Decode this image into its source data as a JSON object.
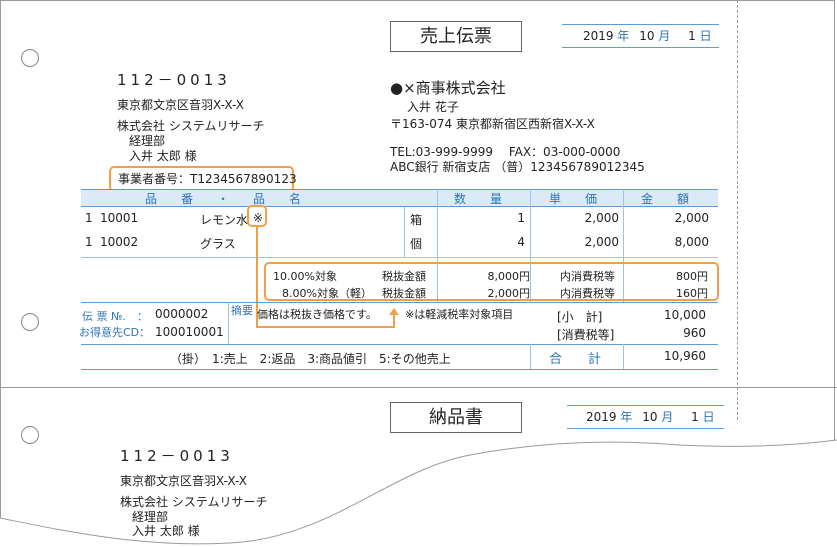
{
  "slip": {
    "title": "売上伝票",
    "date": {
      "year": "2019",
      "year_unit": "年",
      "month": "10",
      "month_unit": "月",
      "day": "1",
      "day_unit": "日"
    },
    "recipient": {
      "zip": "112－0013",
      "address": "東京都文京区音羽X-X-X",
      "company": "株式会社 システムリサーチ",
      "department": "経理部",
      "person": "入井 太郎 様"
    },
    "registration": "事業者番号：T1234567890123",
    "sender": {
      "company": "●×商事株式会社",
      "person": "入井 花子",
      "address": "〒163-074 東京都新宿区西新宿X-X-X",
      "tel_fax": "TEL:03-999-9999　 FAX：03-000-0000",
      "bank": "ABC銀行 新宿支店 （普）123456789012345"
    },
    "table": {
      "headers": {
        "item": "品　　番　　・　　品　　名",
        "quantity": "数　　量",
        "unit_price": "単　　価",
        "amount": "金　　額"
      },
      "rows": [
        {
          "no": "1",
          "code": "10001",
          "name": "レモン水",
          "mark": "※",
          "unit": "箱",
          "qty": "1",
          "price": "2,000",
          "amount": "2,000"
        },
        {
          "no": "1",
          "code": "10002",
          "name": "グラス",
          "mark": "",
          "unit": "個",
          "qty": "4",
          "price": "2,000",
          "amount": "8,000"
        }
      ],
      "tax_rows": [
        {
          "target": "10.00%対象",
          "label": "税抜金額",
          "value": "8,000円",
          "tax_label": "内消費税等",
          "tax": "800円"
        },
        {
          "target": "8.00%対象（軽）",
          "label": "税抜金額",
          "value": "2,000円",
          "tax_label": "内消費税等",
          "tax": "160円"
        }
      ]
    },
    "footer": {
      "slip_no_label": "伝 票 №.　：",
      "slip_no": "0000002",
      "customer_cd_label": "お得意先CD：",
      "customer_cd": "100010001",
      "memo_label": "摘要",
      "memo": "価格は税抜き価格です。",
      "note": "※は軽減税率対象項目",
      "subtotal_label": "[小　計]",
      "subtotal": "10,000",
      "tax_label": "[消費税等]",
      "tax": "960",
      "kake": "（掛）　1:売上　2:返品　3:商品値引　5:その他売上",
      "total_label": "合　　計",
      "total": "10,960"
    }
  },
  "delivery": {
    "title": "納品書",
    "date": {
      "year": "2019",
      "year_unit": "年",
      "month": "10",
      "month_unit": "月",
      "day": "1",
      "day_unit": "日"
    },
    "recipient": {
      "zip": "112－0013",
      "address": "東京都文京区音羽X-X-X",
      "company": "株式会社 システムリサーチ",
      "department": "経理部",
      "person": "入井 太郎 様"
    }
  },
  "colors": {
    "accent_blue": "#2e75b6",
    "header_fill": "#dce9f7",
    "highlight_orange": "#f0a04b"
  }
}
